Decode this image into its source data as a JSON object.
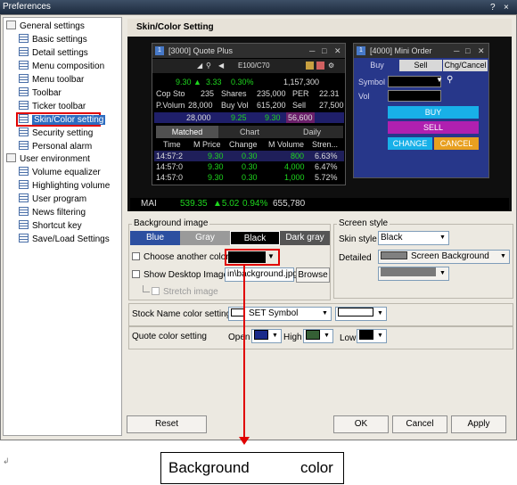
{
  "window": {
    "title": "Preferences",
    "help_glyph": "?",
    "close_glyph": "×"
  },
  "tree": {
    "groups": [
      {
        "label": "General settings"
      },
      {
        "label": "User environment"
      }
    ],
    "general_items": [
      "Basic settings",
      "Detail settings",
      "Menu composition",
      "Menu toolbar",
      "Toolbar",
      "Ticker toolbar",
      "Skin/Color setting",
      "Security setting",
      "Personal alarm"
    ],
    "env_items": [
      "Volume equalizer",
      "Highlighting volume",
      "User program",
      "News filtering",
      "Shortcut key",
      "Save/Load Settings"
    ],
    "selected_item": "Skin/Color setting"
  },
  "panel": {
    "header": "Skin/Color Setting"
  },
  "preview": {
    "quote_plus": {
      "num": "1",
      "title": "[3000] Quote Plus",
      "symbol": "E100/C70",
      "rows": [
        {
          "cols": [
            "9.30 ▲",
            "3.33",
            "0.30%",
            "1,157,300"
          ]
        },
        {
          "cols": [
            "Cop Sto",
            "235",
            "Shares",
            "235,000",
            "PER",
            "22.31"
          ]
        },
        {
          "cols": [
            "P.Volum",
            "28,000",
            "Buy Vol",
            "615,200",
            "Sell",
            "27,500"
          ]
        },
        {
          "cols": [
            "28,000",
            "9.25",
            "9.30",
            "56,600"
          ]
        }
      ],
      "tabs": [
        "Matched",
        "Chart",
        "Daily"
      ],
      "table_header": [
        "Time",
        "M Price",
        "Change",
        "M Volume",
        "Stren..."
      ],
      "trades": [
        {
          "time": "14:57:2",
          "price": "9.30",
          "change": "0.30",
          "volume": "800",
          "strength": "6.63%"
        },
        {
          "time": "14:57:0",
          "price": "9.30",
          "change": "0.30",
          "volume": "4,000",
          "strength": "6.47%"
        },
        {
          "time": "14:57:0",
          "price": "9.30",
          "change": "0.30",
          "volume": "1,000",
          "strength": "5.72%"
        }
      ]
    },
    "mini_order": {
      "num": "1",
      "title": "[4000] Mini Order",
      "tabs": [
        "Buy",
        "Sell",
        "Chg/Cancel"
      ],
      "symbol_label": "Symbol",
      "vol_label": "Vol",
      "buy_label": "BUY",
      "sell_label": "SELL",
      "change_label": "CHANGE",
      "cancel_label": "CANCEL"
    },
    "status": {
      "name": "MAI",
      "value": "539.35",
      "change": "▲5.02",
      "pct": "0.94%",
      "volume": "655,780"
    }
  },
  "background_image": {
    "group_label": "Background image",
    "options": [
      "Blue",
      "Gray",
      "Black",
      "Dark gray"
    ],
    "selected": "Black",
    "choose_color_label": "Choose another color",
    "show_desktop_label": "Show Desktop Image",
    "file_path": "in\\background.jpg",
    "browse_label": "Browse",
    "stretch_label": "Stretch image"
  },
  "screen_style": {
    "group_label": "Screen style",
    "skin_label": "Skin style",
    "skin_value": "Black",
    "detailed_label": "Detailed",
    "detailed_value": "Screen Background"
  },
  "stock_name": {
    "label": "Stock Name color setting",
    "symbol_value": "SET Symbol"
  },
  "quote_color": {
    "label": "Quote color setting",
    "open_label": "Open",
    "high_label": "High",
    "low_label": "Low"
  },
  "buttons": {
    "reset": "Reset",
    "ok": "OK",
    "cancel": "Cancel",
    "apply": "Apply"
  },
  "callout": {
    "left": "Background",
    "right": "color"
  },
  "colors": {
    "accent_red": "#e00000",
    "selection_blue": "#2d6cc0",
    "open_color": "#1a2a8a",
    "high_color": "#355f35",
    "low_color": "#000000"
  }
}
